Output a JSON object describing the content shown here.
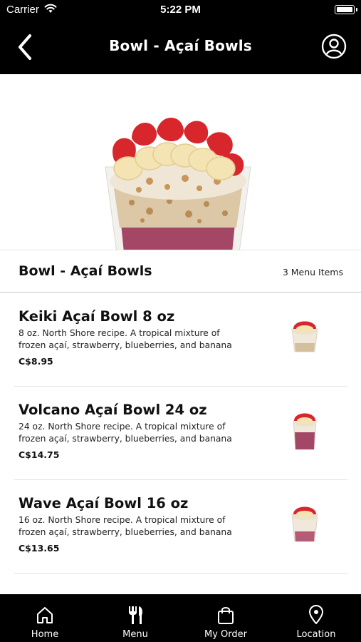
{
  "status_bar": {
    "carrier": "Carrier",
    "time": "5:22 PM"
  },
  "header": {
    "title": "Bowl - Açaí Bowls",
    "back_icon": "chevron-left-icon",
    "profile_icon": "user-circle-icon"
  },
  "category": {
    "title": "Bowl - Açaí Bowls",
    "count_label": "3 Menu Items"
  },
  "items": [
    {
      "name": "Keiki Açaí Bowl 8 oz",
      "description": "8 oz. North Shore recipe. A tropical mixture of frozen açaí, strawberry, blueberries, and banana",
      "price": "C$8.95"
    },
    {
      "name": "Volcano Açaí Bowl 24 oz",
      "description": "24 oz. North Shore recipe. A tropical mixture of frozen açaí, strawberry, blueberries, and banana",
      "price": "C$14.75"
    },
    {
      "name": "Wave Açaí Bowl 16 oz",
      "description": "16 oz. North Shore recipe. A tropical mixture of frozen açaí, strawberry, blueberries, and banana",
      "price": "C$13.65"
    }
  ],
  "tabbar": {
    "tabs": [
      {
        "label": "Home",
        "icon": "home-icon"
      },
      {
        "label": "Menu",
        "icon": "fork-knife-icon"
      },
      {
        "label": "My Order",
        "icon": "shopping-bag-icon"
      },
      {
        "label": "Location",
        "icon": "map-pin-icon"
      }
    ]
  },
  "colors": {
    "header_bg": "#000000",
    "text": "#111111",
    "divider": "#e3e3e3"
  }
}
